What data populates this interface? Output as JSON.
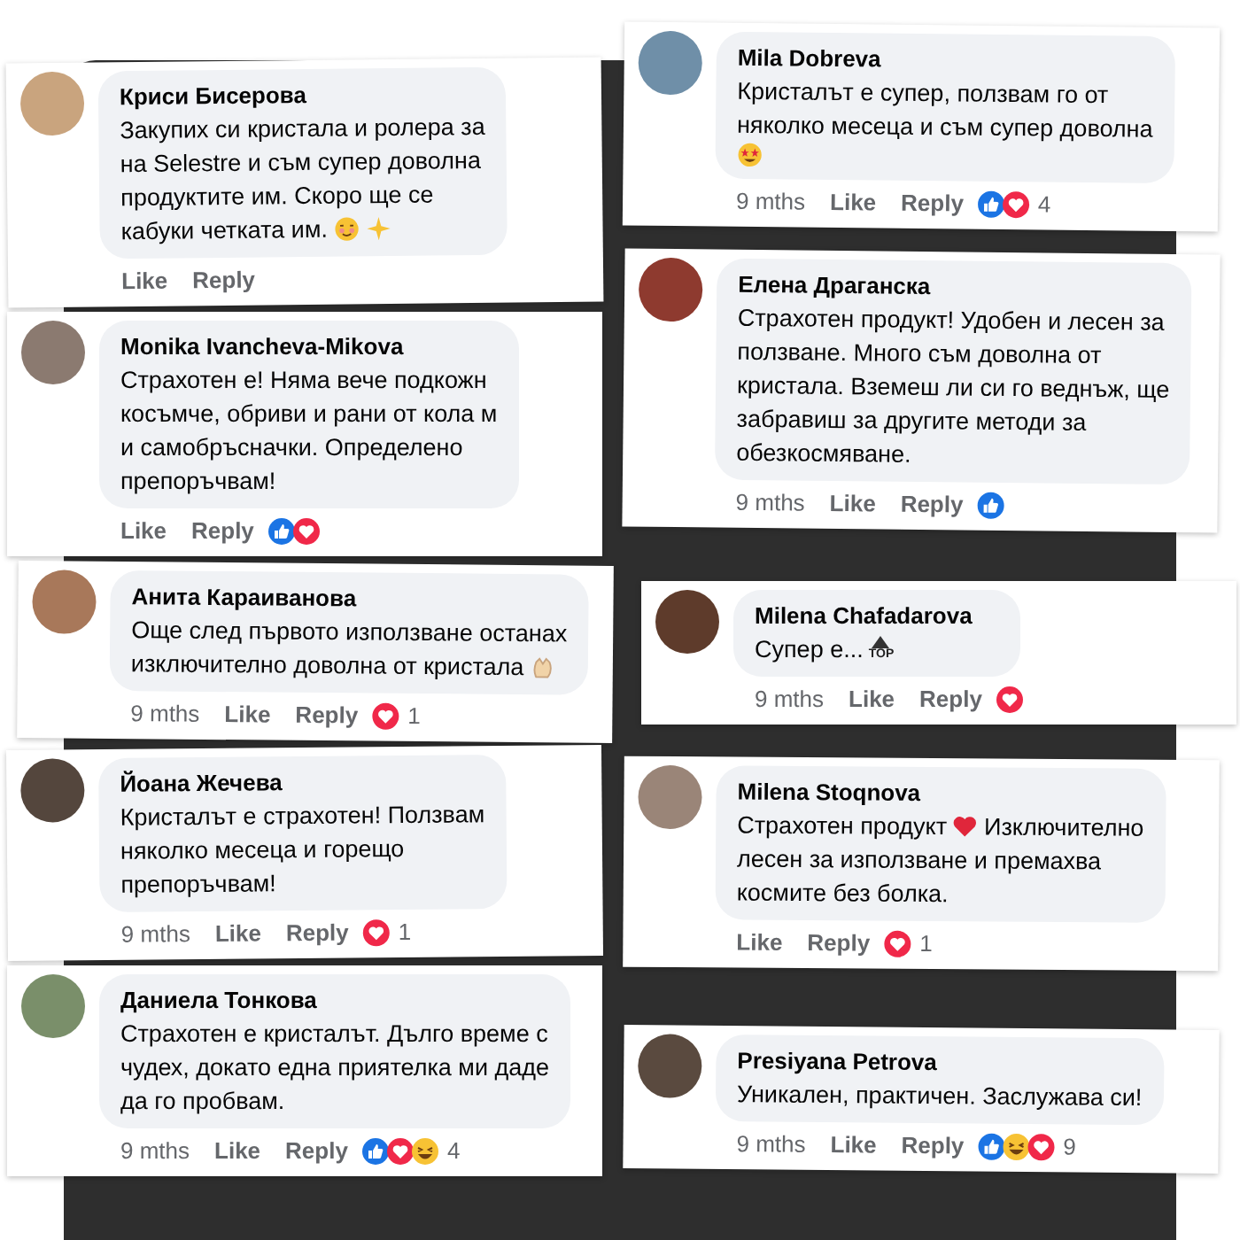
{
  "comments": [
    {
      "author": "Криси Бисерова",
      "lines": [
        [
          {
            "kind": "text",
            "text": "Закупих си кристала и ролера за"
          }
        ],
        [
          {
            "kind": "text",
            "text": "на Selestre и съм супер доволна"
          }
        ],
        [
          {
            "kind": "text",
            "text": "продуктите им. Скоро ще се"
          }
        ],
        [
          {
            "kind": "text",
            "text": "кабуки четката им."
          },
          {
            "kind": "smiley"
          },
          {
            "kind": "sparkle"
          }
        ]
      ],
      "like": "Like",
      "reply": "Reply"
    },
    {
      "author": "Mila Dobreva",
      "lines": [
        [
          {
            "kind": "text",
            "text": "Кристалът е супер, ползвам го от"
          }
        ],
        [
          {
            "kind": "text",
            "text": "няколко месеца и съм супер доволна"
          }
        ],
        [
          {
            "kind": "starry"
          }
        ]
      ],
      "time": "9 mths",
      "like": "Like",
      "reply": "Reply",
      "reactions": [
        {
          "kind": "like"
        },
        {
          "kind": "love"
        }
      ],
      "count": "4"
    },
    {
      "author": "Monika Ivancheva-Mikova",
      "lines": [
        [
          {
            "kind": "text",
            "text": "Страхотен е! Няма вече подкожн"
          }
        ],
        [
          {
            "kind": "text",
            "text": "косъмче, обриви и рани от кола м"
          }
        ],
        [
          {
            "kind": "text",
            "text": "и самобръсначки. Определено"
          }
        ],
        [
          {
            "kind": "text",
            "text": "препоръчвам!"
          }
        ]
      ],
      "like": "Like",
      "reply": "Reply",
      "reactions": [
        {
          "kind": "like"
        },
        {
          "kind": "love"
        }
      ]
    },
    {
      "author": "Елена Драганска",
      "lines": [
        [
          {
            "kind": "text",
            "text": "Страхотен продукт! Удобен и лесен за"
          }
        ],
        [
          {
            "kind": "text",
            "text": "ползване. Много съм доволна от"
          }
        ],
        [
          {
            "kind": "text",
            "text": "кристала. Вземеш ли си го веднъж, ще"
          }
        ],
        [
          {
            "kind": "text",
            "text": "забравиш за другите методи за"
          }
        ],
        [
          {
            "kind": "text",
            "text": "обезкосмяване."
          }
        ]
      ],
      "time": "9 mths",
      "like": "Like",
      "reply": "Reply",
      "reactions": [
        {
          "kind": "like"
        }
      ]
    },
    {
      "author": "Анита Караиванова",
      "lines": [
        [
          {
            "kind": "text",
            "text": "Още след първото използване останах"
          }
        ],
        [
          {
            "kind": "text",
            "text": "изключително доволна от кристала"
          },
          {
            "kind": "clap"
          }
        ]
      ],
      "time": "9 mths",
      "like": "Like",
      "reply": "Reply",
      "reactions": [
        {
          "kind": "love"
        }
      ],
      "count": "1"
    },
    {
      "author": "Milena Chafadarova",
      "lines": [
        [
          {
            "kind": "text",
            "text": "Супер е..."
          },
          {
            "kind": "top",
            "text": "TOP"
          }
        ]
      ],
      "time": "9 mths",
      "like": "Like",
      "reply": "Reply",
      "reactions": [
        {
          "kind": "love"
        }
      ]
    },
    {
      "author": "Йоана Жечева",
      "lines": [
        [
          {
            "kind": "text",
            "text": "Кристалът е страхотен! Ползвам"
          }
        ],
        [
          {
            "kind": "text",
            "text": "няколко месеца и горещо"
          }
        ],
        [
          {
            "kind": "text",
            "text": "препоръчвам!"
          }
        ]
      ],
      "time": "9 mths",
      "like": "Like",
      "reply": "Reply",
      "reactions": [
        {
          "kind": "love"
        }
      ],
      "count": "1"
    },
    {
      "author": "Milena Stoqnova",
      "lines": [
        [
          {
            "kind": "text",
            "text": "Страхотен продукт"
          },
          {
            "kind": "heart"
          },
          {
            "kind": "text",
            "text": "Изключително"
          }
        ],
        [
          {
            "kind": "text",
            "text": "лесен за използване и премахва"
          }
        ],
        [
          {
            "kind": "text",
            "text": "космите без болка."
          }
        ]
      ],
      "like": "Like",
      "reply": "Reply",
      "reactions": [
        {
          "kind": "love"
        }
      ],
      "count": "1"
    },
    {
      "author": "Даниела Тонкова",
      "lines": [
        [
          {
            "kind": "text",
            "text": "Страхотен е кристалът. Дълго време с"
          }
        ],
        [
          {
            "kind": "text",
            "text": "чудех, докато една приятелка ми даде"
          }
        ],
        [
          {
            "kind": "text",
            "text": "да го пробвам."
          }
        ]
      ],
      "time": "9 mths",
      "like": "Like",
      "reply": "Reply",
      "reactions": [
        {
          "kind": "like"
        },
        {
          "kind": "love"
        },
        {
          "kind": "haha"
        }
      ],
      "count": "4"
    },
    {
      "author": "Presiyana Petrova",
      "lines": [
        [
          {
            "kind": "text",
            "text": "Уникален, практичен. Заслужава си!"
          }
        ]
      ],
      "time": "9 mths",
      "like": "Like",
      "reply": "Reply",
      "reactions": [
        {
          "kind": "like"
        },
        {
          "kind": "haha"
        },
        {
          "kind": "love"
        }
      ],
      "count": "9"
    }
  ]
}
